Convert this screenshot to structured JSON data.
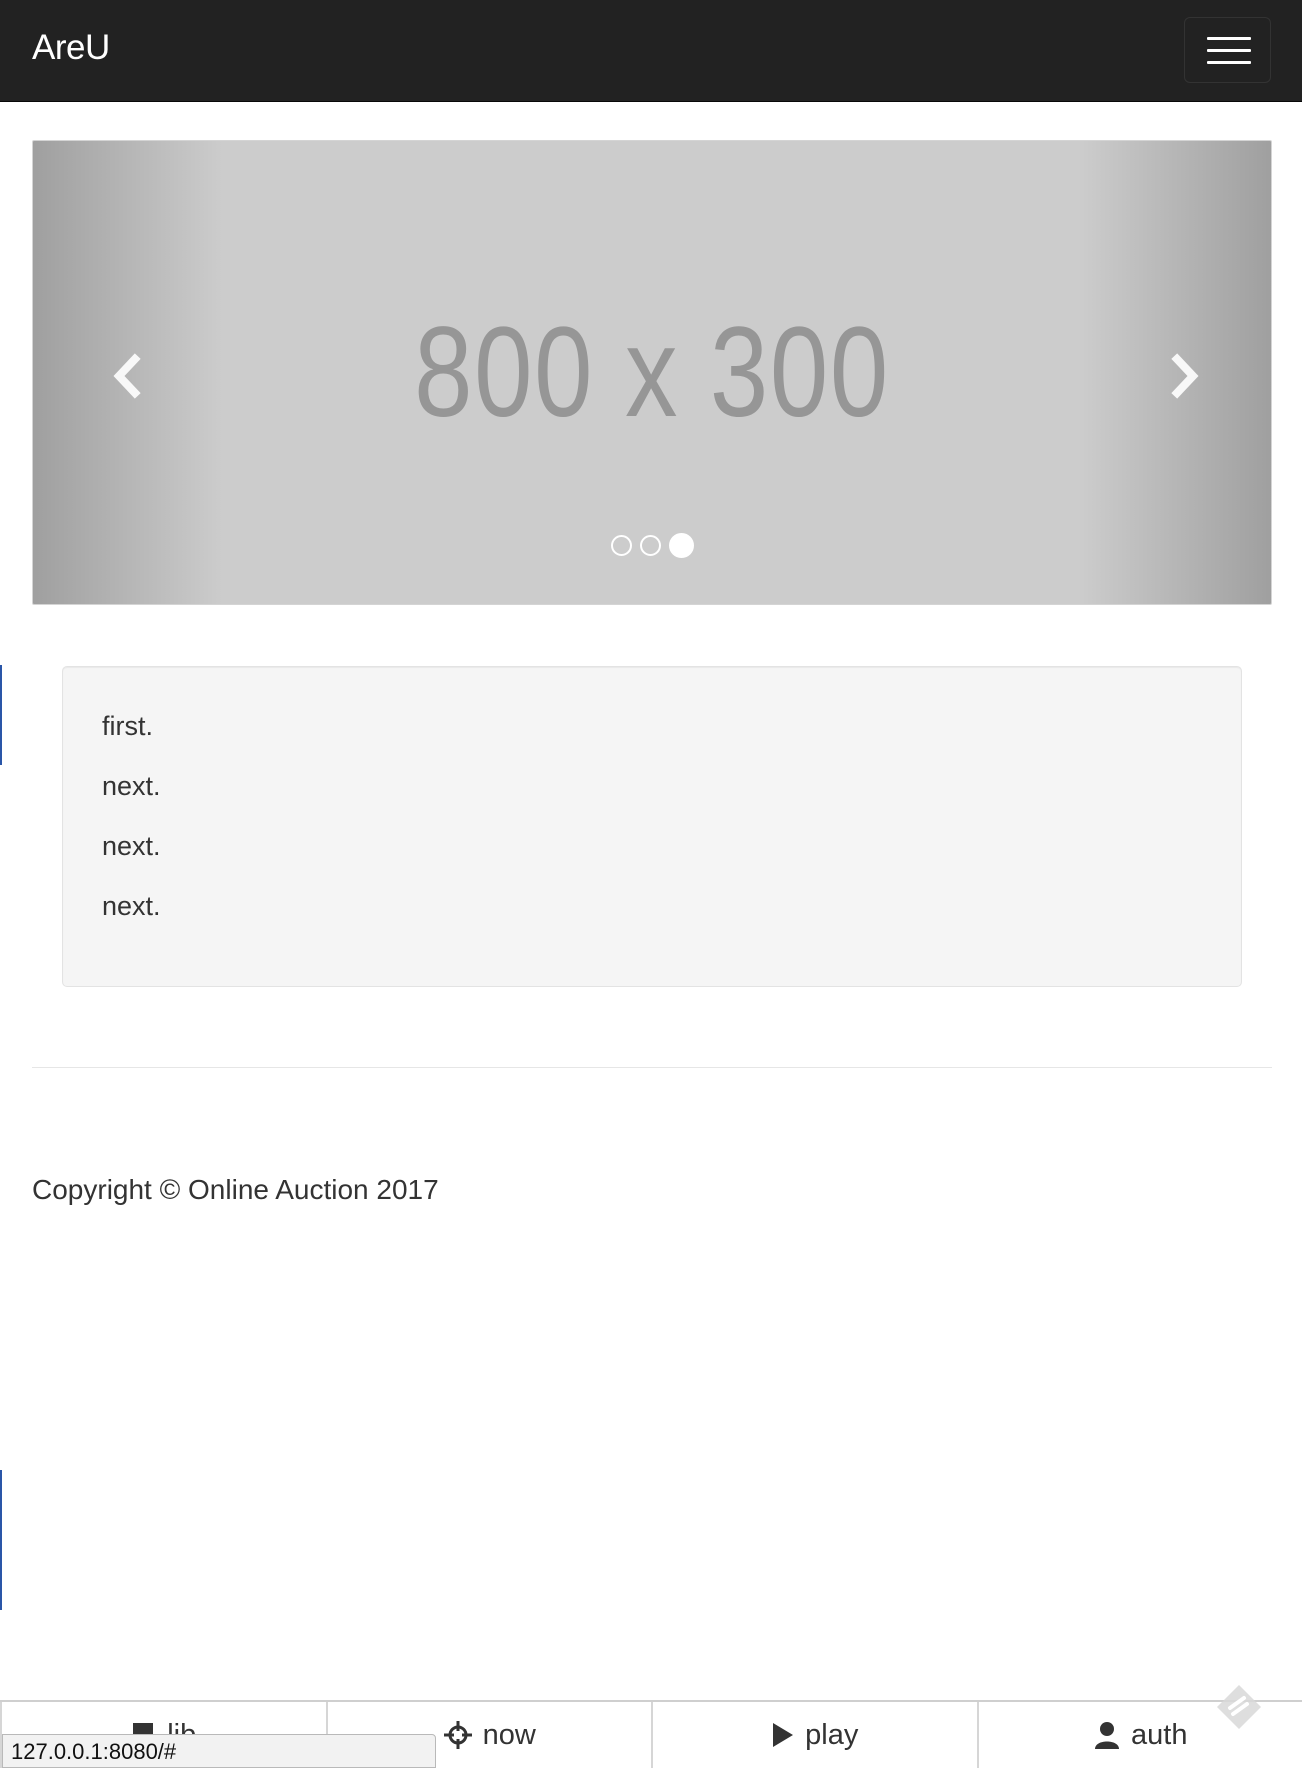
{
  "navbar": {
    "brand": "AreU"
  },
  "carousel": {
    "placeholder": "800 x 300",
    "slide_count": 3,
    "active_index": 2
  },
  "well": {
    "lines": [
      "first.",
      "next.",
      "next.",
      "next."
    ]
  },
  "footer": {
    "copyright": "Copyright © Online Auction 2017"
  },
  "tabbar": {
    "tabs": [
      {
        "label": "lib",
        "icon": "book-icon"
      },
      {
        "label": "now",
        "icon": "crosshair-icon"
      },
      {
        "label": "play",
        "icon": "play-icon"
      },
      {
        "label": "auth",
        "icon": "user-icon"
      }
    ]
  },
  "status_bar": {
    "url": "127.0.0.1:8080/#"
  },
  "colors": {
    "navbar_bg": "#222222",
    "carousel_bg": "#cccccc",
    "well_bg": "#f5f5f5"
  }
}
